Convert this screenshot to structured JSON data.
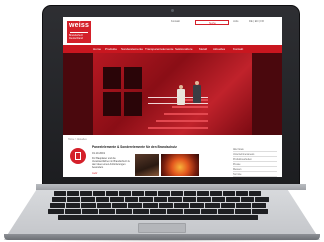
{
  "site": {
    "logo_text": "weiss",
    "logo_sub": "Brandschutz Deutschland",
    "top_links": [
      "Kontakt",
      "Jobs",
      "DE | EN | FR"
    ],
    "search_placeholder": "Suche",
    "nav": [
      "Home",
      "Produkte",
      "Sonderelemente",
      "Transparentelemente",
      "Sektionaltore",
      "Metall",
      "Aktuelles",
      "Kontakt"
    ]
  },
  "content": {
    "breadcrumb": "Home > Aktuelles",
    "article": {
      "title": "Paneelelemente & Sonderelemente für den Brandschutz",
      "date": "01.10.2019",
      "text": "Für Bauplaner und die Verantwortlichen im Brandschutz zu den Ideen einen Anforderungen besonders",
      "more": "mehr"
    },
    "sidebar": [
      "Alle News",
      "Unternehmensnews",
      "Produktneuheiten",
      "Presse",
      "Messen",
      "Termine",
      "Sonstiges"
    ]
  },
  "colors": {
    "brand_red": "#d4202a",
    "nav_red": "#c9161f"
  }
}
